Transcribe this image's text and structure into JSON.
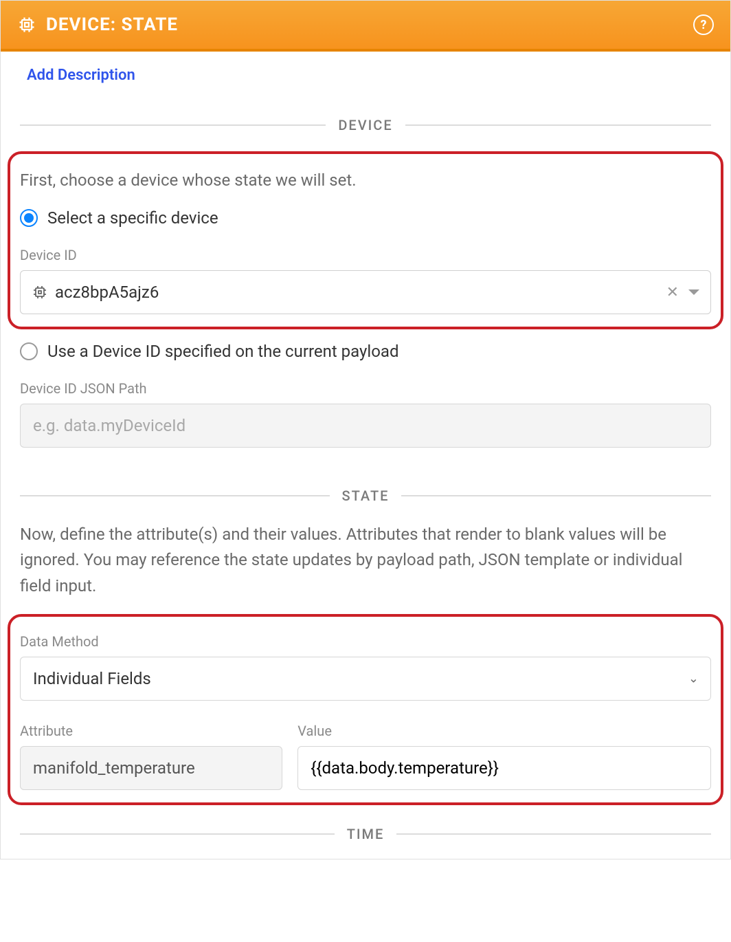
{
  "header": {
    "title": "DEVICE: STATE"
  },
  "links": {
    "add_description": "Add Description"
  },
  "sections": {
    "device": "DEVICE",
    "state": "STATE",
    "time": "TIME"
  },
  "device": {
    "instruction": "First, choose a device whose state we will set.",
    "radio_specific": "Select a specific device",
    "radio_payload": "Use a Device ID specified on the current payload",
    "device_id_label": "Device ID",
    "device_id_value": "acz8bpA5ajz6",
    "json_path_label": "Device ID JSON Path",
    "json_path_placeholder": "e.g. data.myDeviceId"
  },
  "state": {
    "instruction": "Now, define the attribute(s) and their values. Attributes that render to blank values will be ignored. You may reference the state updates by payload path, JSON template or individual field input.",
    "data_method_label": "Data Method",
    "data_method_value": "Individual Fields",
    "attribute_label": "Attribute",
    "value_label": "Value",
    "rows": [
      {
        "attribute": "manifold_temperature",
        "value": "{{data.body.temperature}}"
      }
    ]
  }
}
